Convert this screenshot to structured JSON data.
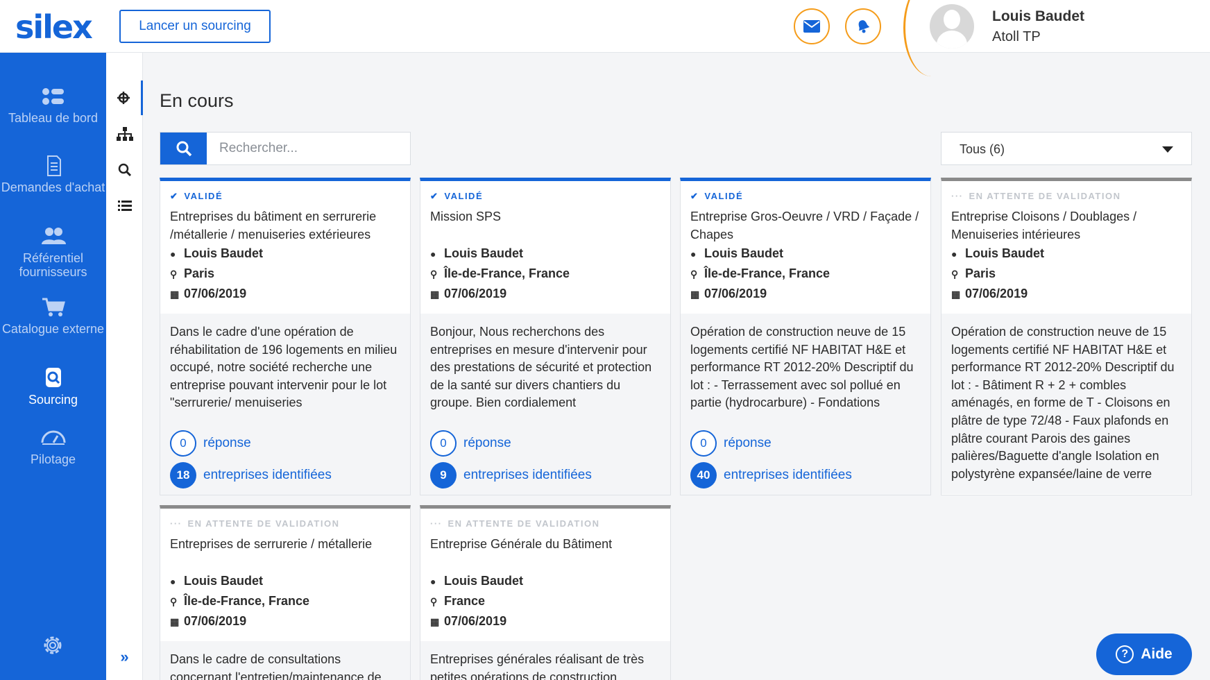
{
  "header": {
    "logo": "silex",
    "sourcing_button": "Lancer un sourcing",
    "mail_icon": "mail-icon",
    "notification_icon": "bell-icon",
    "user": {
      "name": "Louis Baudet",
      "company": "Atoll TP"
    }
  },
  "sidebar": {
    "items": [
      {
        "label": "Tableau de bord",
        "icon": "dashboard-icon"
      },
      {
        "label": "Demandes d'achat",
        "icon": "document-icon"
      },
      {
        "label": "Référentiel fournisseurs",
        "icon": "users-icon"
      },
      {
        "label": "Catalogue externe",
        "icon": "cart-icon"
      },
      {
        "label": "Sourcing",
        "icon": "sourcing-icon"
      },
      {
        "label": "Pilotage",
        "icon": "gauge-icon"
      }
    ],
    "settings_icon": "gear-icon"
  },
  "subnav": {
    "items": [
      "target-icon",
      "hierarchy-icon",
      "search-icon",
      "list-icon"
    ],
    "expand": "»"
  },
  "main": {
    "title": "En cours",
    "search_placeholder": "Rechercher...",
    "filter": "Tous (6)"
  },
  "cards": [
    {
      "status": "VALIDÉ",
      "title": "Entreprises du bâtiment en serrurerie /métallerie / menuiseries extérieures",
      "user": "Louis Baudet",
      "location": "Paris",
      "date": "07/06/2019",
      "description": "Dans le cadre d'une opération de réhabilitation de 196 logements en milieu occupé, notre société recherche une entreprise pouvant intervenir pour le lot \"serrurerie/ menuiseries",
      "responses": "0",
      "responses_label": "réponse",
      "companies": "18",
      "companies_label": "entreprises identifiées"
    },
    {
      "status": "VALIDÉ",
      "title": "Mission SPS",
      "user": "Louis Baudet",
      "location": "Île-de-France, France",
      "date": "07/06/2019",
      "description": "Bonjour, Nous recherchons des entreprises en mesure d'intervenir pour des prestations de sécurité et protection de la santé sur divers chantiers du groupe. Bien cordialement",
      "responses": "0",
      "responses_label": "réponse",
      "companies": "9",
      "companies_label": "entreprises identifiées"
    },
    {
      "status": "VALIDÉ",
      "title": "Entreprise Gros-Oeuvre / VRD / Façade / Chapes",
      "user": "Louis Baudet",
      "location": "Île-de-France, France",
      "date": "07/06/2019",
      "description": "Opération de construction neuve de 15 logements certifié NF HABITAT H&E et performance RT 2012-20% Descriptif du lot : - Terrassement avec sol pollué en partie (hydrocarbure) - Fondations",
      "responses": "0",
      "responses_label": "réponse",
      "companies": "40",
      "companies_label": "entreprises identifiées"
    },
    {
      "status": "EN ATTENTE DE VALIDATION",
      "title": "Entreprise Cloisons / Doublages / Menuiseries intérieures",
      "user": "Louis Baudet",
      "location": "Paris",
      "date": "07/06/2019",
      "description": "Opération de construction neuve de 15 logements certifié NF HABITAT H&E et performance RT 2012-20% Descriptif du lot : - Bâtiment R + 2 + combles aménagés, en forme de T - Cloisons en plâtre de type 72/48 - Faux plafonds en plâtre courant Parois des gaines palières/Baguette d'angle Isolation en polystyrène expansée/laine de verre"
    },
    {
      "status": "EN ATTENTE DE VALIDATION",
      "title": "Entreprises de serrurerie / métallerie",
      "user": "Louis Baudet",
      "location": "Île-de-France, France",
      "date": "07/06/2019",
      "description": "Dans le cadre de consultations concernant l'entretien/maintenance de"
    },
    {
      "status": "EN ATTENTE DE VALIDATION",
      "title": "Entreprise Générale du Bâtiment",
      "user": "Louis Baudet",
      "location": "France",
      "date": "07/06/2019",
      "description": "Entreprises générales réalisant de très petites opérations de construction"
    }
  ],
  "help_button": "Aide",
  "colors": {
    "primary": "#1565d8",
    "accent": "#f59c1a",
    "pending": "#8a8a8a"
  }
}
